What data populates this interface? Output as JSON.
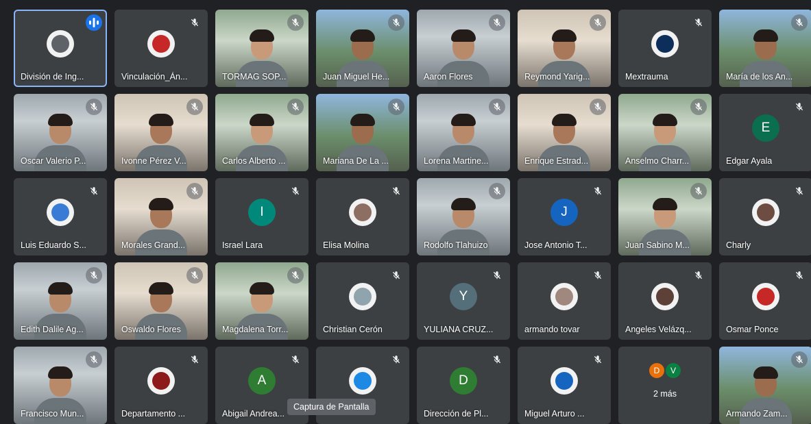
{
  "colors": {
    "background": "#202124",
    "tile": "#3c4043",
    "active_border": "#8ab4f8",
    "speaking": "#1a73e8"
  },
  "tooltip": "Captura de Pantalla",
  "participants": [
    {
      "name": "División de Ing...",
      "kind": "avatar-img",
      "avatar_color": "#5f6368",
      "speaking": true
    },
    {
      "name": "Vinculación_Án...",
      "kind": "avatar-img",
      "avatar_color": "#c62828"
    },
    {
      "name": "TORMAG SOP...",
      "kind": "video"
    },
    {
      "name": "Juan Miguel He...",
      "kind": "video"
    },
    {
      "name": "Aaron Flores",
      "kind": "video"
    },
    {
      "name": "Reymond Yarig...",
      "kind": "video"
    },
    {
      "name": "Mextrauma",
      "kind": "avatar-img",
      "avatar_color": "#0d2d5a"
    },
    {
      "name": "María de los An...",
      "kind": "video"
    },
    {
      "name": "Oscar Valerio P...",
      "kind": "video"
    },
    {
      "name": "Ivonne Pérez V...",
      "kind": "video"
    },
    {
      "name": "Carlos Alberto ...",
      "kind": "video"
    },
    {
      "name": "Mariana De La ...",
      "kind": "video"
    },
    {
      "name": "Lorena Martine...",
      "kind": "video"
    },
    {
      "name": "Enrique Estrad...",
      "kind": "video"
    },
    {
      "name": "Anselmo Charr...",
      "kind": "video"
    },
    {
      "name": "Edgar Ayala",
      "kind": "initial",
      "initial": "E",
      "avatar_color": "#0b6e4f"
    },
    {
      "name": "Luis Eduardo S...",
      "kind": "avatar-img",
      "avatar_color": "#3a7bd5"
    },
    {
      "name": "Morales Grand...",
      "kind": "video"
    },
    {
      "name": "Israel Lara",
      "kind": "initial",
      "initial": "I",
      "avatar_color": "#00897b"
    },
    {
      "name": "Elisa Molina",
      "kind": "avatar-img",
      "avatar_color": "#8d6e63"
    },
    {
      "name": "Rodolfo Tlahuizo",
      "kind": "video"
    },
    {
      "name": "Jose Antonio T...",
      "kind": "initial",
      "initial": "J",
      "avatar_color": "#1565c0"
    },
    {
      "name": "Juan Sabino M...",
      "kind": "video"
    },
    {
      "name": "Charly",
      "kind": "avatar-img",
      "avatar_color": "#6d4c41"
    },
    {
      "name": "Edith Dalile Ag...",
      "kind": "video"
    },
    {
      "name": "Oswaldo Flores",
      "kind": "video"
    },
    {
      "name": "Magdalena Torr...",
      "kind": "video"
    },
    {
      "name": "Christian Cerón",
      "kind": "avatar-img",
      "avatar_color": "#90a4ae"
    },
    {
      "name": "YULIANA CRUZ...",
      "kind": "initial",
      "initial": "Y",
      "avatar_color": "#546e7a"
    },
    {
      "name": "armando tovar",
      "kind": "avatar-img",
      "avatar_color": "#a1887f"
    },
    {
      "name": "Angeles Velázq...",
      "kind": "avatar-img",
      "avatar_color": "#5d4037"
    },
    {
      "name": "Osmar Ponce",
      "kind": "avatar-img",
      "avatar_color": "#c62828"
    },
    {
      "name": "Francisco Mun...",
      "kind": "video"
    },
    {
      "name": "Departamento ...",
      "kind": "avatar-img",
      "avatar_color": "#8e1b1b"
    },
    {
      "name": "Abigail Andrea...",
      "kind": "initial",
      "initial": "A",
      "avatar_color": "#2e7d32"
    },
    {
      "name": "",
      "kind": "avatar-img",
      "avatar_color": "#1e88e5"
    },
    {
      "name": "Dirección de Pl...",
      "kind": "initial",
      "initial": "D",
      "avatar_color": "#2e7d32"
    },
    {
      "name": "Miguel Arturo ...",
      "kind": "avatar-img",
      "avatar_color": "#1565c0"
    },
    {
      "name": "",
      "kind": "more",
      "more_label": "2 más",
      "more_initials": [
        "D",
        "V"
      ],
      "more_colors": [
        "#e8710a",
        "#0b8043"
      ]
    },
    {
      "name": "Armando Zam...",
      "kind": "video"
    }
  ]
}
